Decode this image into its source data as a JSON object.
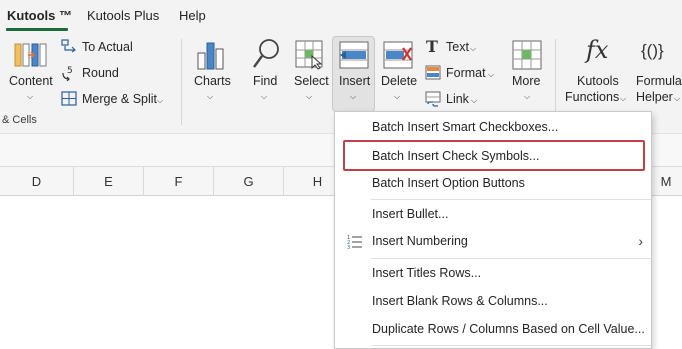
{
  "tabs": [
    {
      "label": "Kutools ™",
      "active": true
    },
    {
      "label": "Kutools Plus",
      "active": false
    },
    {
      "label": "Help",
      "active": false
    }
  ],
  "ribbon": {
    "content_label": "Content",
    "to_actual_label": "To Actual",
    "round_label": "Round",
    "merge_split_label": "Merge & Split",
    "group_cells_label": "& Cells",
    "charts_label": "Charts",
    "find_label": "Find",
    "select_label": "Select",
    "insert_label": "Insert",
    "delete_label": "Delete",
    "text_label": "Text",
    "format_label": "Format",
    "link_label": "Link",
    "more_label": "More",
    "kutools_functions_label_1": "Kutools",
    "kutools_functions_label_2": "Functions",
    "formula_helper_label_1": "Formula",
    "formula_helper_label_2": "Helper",
    "fx_glyph": "fx",
    "braces_glyph": "{()}"
  },
  "columns": [
    "D",
    "E",
    "F",
    "G",
    "H",
    "M"
  ],
  "insert_menu": {
    "items": [
      {
        "label": "Batch Insert Smart Checkboxes...",
        "icon": "",
        "submenu": false
      },
      {
        "label": "Batch Insert Check Symbols...",
        "icon": "",
        "submenu": false,
        "highlighted": true
      },
      {
        "label": "Batch Insert Option Buttons",
        "icon": "",
        "submenu": false
      },
      {
        "label": "Insert Bullet...",
        "icon": "",
        "submenu": false
      },
      {
        "label": "Insert Numbering",
        "icon": "numbering-icon",
        "submenu": true
      },
      {
        "label": "Insert Titles Rows...",
        "icon": "",
        "submenu": false
      },
      {
        "label": "Insert Blank Rows & Columns...",
        "icon": "",
        "submenu": false
      },
      {
        "label": "Duplicate Rows / Columns Based on Cell Value...",
        "icon": "",
        "submenu": false
      }
    ],
    "submenu_arrow": "›"
  },
  "colors": {
    "active_tab_underline": "#1b6b3a",
    "highlight_border": "#c0414a"
  }
}
